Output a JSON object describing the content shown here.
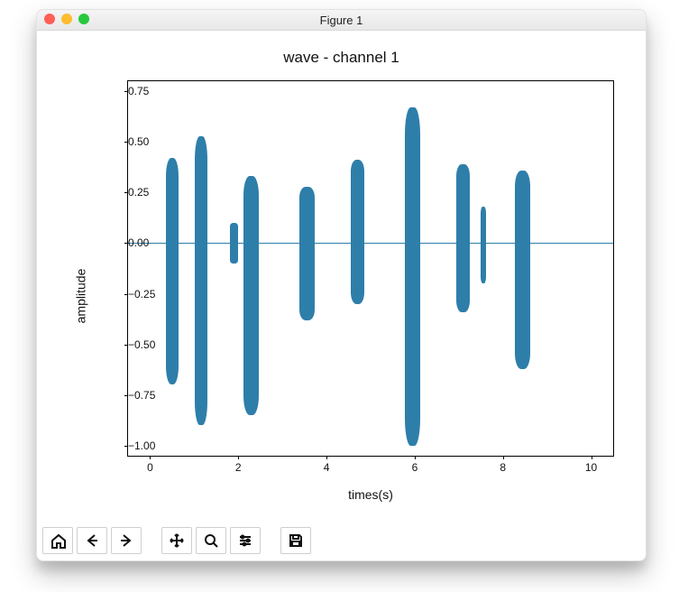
{
  "window": {
    "title": "Figure 1"
  },
  "toolbar": {
    "home": "Home",
    "back": "Back",
    "forward": "Forward",
    "pan": "Pan",
    "zoom": "Zoom",
    "configure": "Configure subplots",
    "save": "Save"
  },
  "chart_data": {
    "type": "line",
    "title": "wave - channel 1",
    "xlabel": "times(s)",
    "ylabel": "amplitude",
    "xlim": [
      -0.5,
      10.5
    ],
    "ylim": [
      -1.05,
      0.8
    ],
    "xticks": [
      0,
      2,
      4,
      6,
      8,
      10
    ],
    "yticks": [
      -1.0,
      -0.75,
      -0.5,
      -0.25,
      0.0,
      0.25,
      0.5,
      0.75
    ],
    "ytick_labels": [
      "−1.00",
      "−0.75",
      "−0.50",
      "−0.25",
      "0.00",
      "0.25",
      "0.50",
      "0.75"
    ],
    "baseline": 0.0,
    "bursts": [
      {
        "t": 0.5,
        "w": 0.3,
        "pos": 0.42,
        "neg": -0.7
      },
      {
        "t": 1.15,
        "w": 0.28,
        "pos": 0.53,
        "neg": -0.9
      },
      {
        "t": 1.9,
        "w": 0.18,
        "pos": 0.1,
        "neg": -0.1
      },
      {
        "t": 2.3,
        "w": 0.35,
        "pos": 0.33,
        "neg": -0.85
      },
      {
        "t": 3.55,
        "w": 0.35,
        "pos": 0.28,
        "neg": -0.38
      },
      {
        "t": 4.7,
        "w": 0.32,
        "pos": 0.41,
        "neg": -0.3
      },
      {
        "t": 5.95,
        "w": 0.33,
        "pos": 0.67,
        "neg": -1.0
      },
      {
        "t": 7.1,
        "w": 0.3,
        "pos": 0.39,
        "neg": -0.34
      },
      {
        "t": 7.55,
        "w": 0.12,
        "pos": 0.18,
        "neg": -0.2
      },
      {
        "t": 8.45,
        "w": 0.35,
        "pos": 0.36,
        "neg": -0.62
      }
    ]
  }
}
